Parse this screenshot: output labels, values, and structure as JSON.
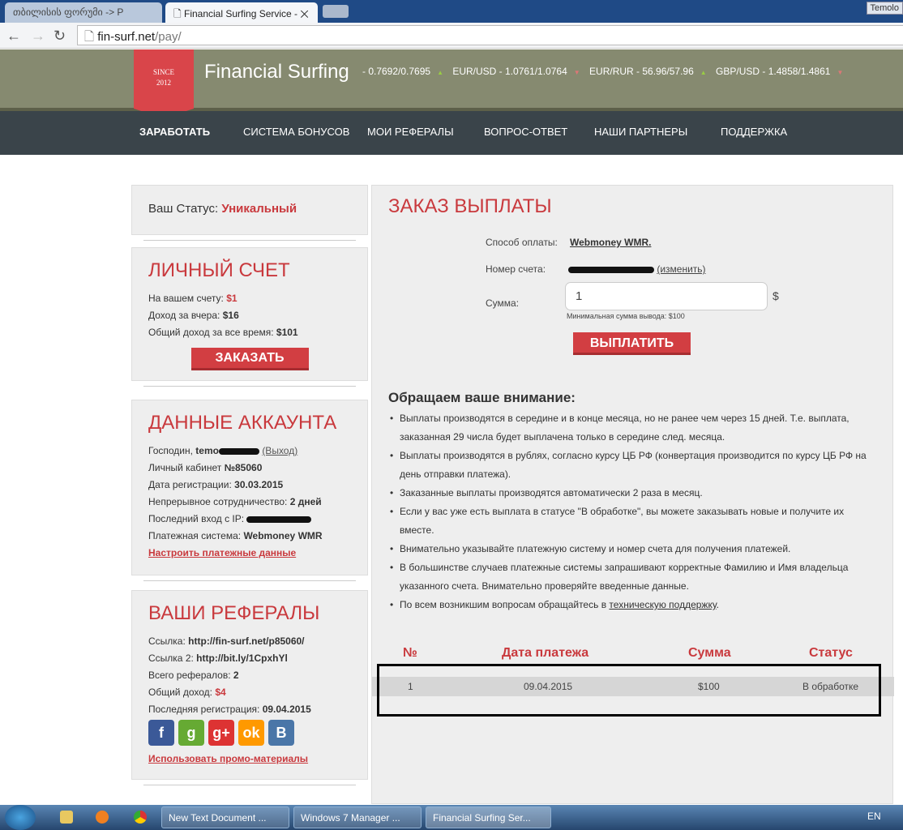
{
  "browser": {
    "tabs": [
      {
        "label": "თბილისის ფორუმი -> P"
      },
      {
        "label": "Financial Surfing Service -"
      }
    ],
    "profile": "Temolo",
    "url_host": "fin-surf.net",
    "url_path": "/pay/"
  },
  "header": {
    "logo_top": "SINCE",
    "logo_year": "2012",
    "brand": "Financial Surfing",
    "tickers": [
      {
        "text": "- 0.7692/0.7695",
        "dir": "up"
      },
      {
        "text": "EUR/USD - 1.0761/1.0764",
        "dir": "down"
      },
      {
        "text": "EUR/RUR - 56.96/57.96",
        "dir": "up"
      },
      {
        "text": "GBP/USD - 1.4858/1.4861",
        "dir": "down"
      }
    ]
  },
  "menu": [
    "ЗАРАБОТАТЬ",
    "СИСТЕМА БОНУСОВ",
    "МОИ РЕФЕРАЛЫ",
    "ВОПРОС-ОТВЕТ",
    "НАШИ ПАРТНЕРЫ",
    "ПОДДЕРЖКА"
  ],
  "status": {
    "label": "Ваш Статус:",
    "value": "Уникальный"
  },
  "account": {
    "title": "ЛИЧНЫЙ СЧЕТ",
    "balance_label": "На вашем счету:",
    "balance": "$1",
    "yesterday_label": "Доход за вчера:",
    "yesterday": "$16",
    "total_label": "Общий доход за все время:",
    "total": "$101",
    "order_button": "ЗАКАЗАТЬ"
  },
  "data": {
    "title": "ДАННЫЕ АККАУНТА",
    "user_label": "Господин,",
    "user": "temo",
    "logout": "(Выход)",
    "cabinet_label": "Личный кабинет",
    "cabinet": "№85060",
    "reg_label": "Дата регистрации:",
    "reg": "30.03.2015",
    "coop_label": "Непрерывное сотрудничество:",
    "coop": "2 дней",
    "ip_label": "Последний вход с IP:",
    "pay_label": "Платежная система:",
    "pay": "Webmoney WMR",
    "setup_link": "Настроить платежные данные"
  },
  "referrals": {
    "title": "ВАШИ РЕФЕРАЛЫ",
    "link_label": "Ссылка:",
    "link": "http://fin-surf.net/p85060/",
    "link2_label": "Ссылка 2:",
    "link2": "http://bit.ly/1CpxhYl",
    "count_label": "Всего рефералов:",
    "count": "2",
    "income_label": "Общий доход:",
    "income": "$4",
    "last_label": "Последняя регистрация:",
    "last": "09.04.2015",
    "promo_link": "Использовать промо-материалы"
  },
  "payout": {
    "title": "ЗАКАЗ ВЫПЛАТЫ",
    "method_label": "Способ оплаты:",
    "method": "Webmoney WMR.",
    "account_label": "Номер счета:",
    "change_link": "(изменить)",
    "amount_label": "Сумма:",
    "amount": "1",
    "currency": "$",
    "min_note": "Минимальная сумма вывода: $100",
    "pay_button": "ВЫПЛАТИТЬ"
  },
  "notes": {
    "title": "Обращаем ваше внимание:",
    "items": [
      "Выплаты производятся в середине и в конце месяца, но не ранее чем через 15 дней. Т.е. выплата, заказанная 29 числа будет выплачена только в середине след. месяца.",
      "Выплаты производятся в рублях, согласно курсу ЦБ РФ (конвертация производится по курсу ЦБ РФ на день отправки платежа).",
      "Заказанные выплаты производятся автоматически 2 раза в месяц.",
      "Если у вас уже есть выплата в статусе \"В обработке\", вы можете заказывать новые и получите их вместе.",
      "Внимательно указывайте платежную систему и номер счета для получения платежей.",
      "В большинстве случаев платежные системы запрашивают корректные Фамилию и Имя владельца указанного счета. Внимательно проверяйте введенные данные."
    ],
    "last_prefix": "По всем возникшим вопросам обращайтесь в",
    "last_link": "техническую поддержку",
    "last_suffix": "."
  },
  "table": {
    "headers": [
      "№",
      "Дата платежа",
      "Сумма",
      "Статус"
    ],
    "rows": [
      [
        "1",
        "09.04.2015",
        "$100",
        "В обработке"
      ]
    ]
  },
  "taskbar": {
    "windows": [
      "New Text Document ...",
      "Windows 7 Manager ...",
      "Financial Surfing Ser..."
    ],
    "lang": "EN"
  }
}
